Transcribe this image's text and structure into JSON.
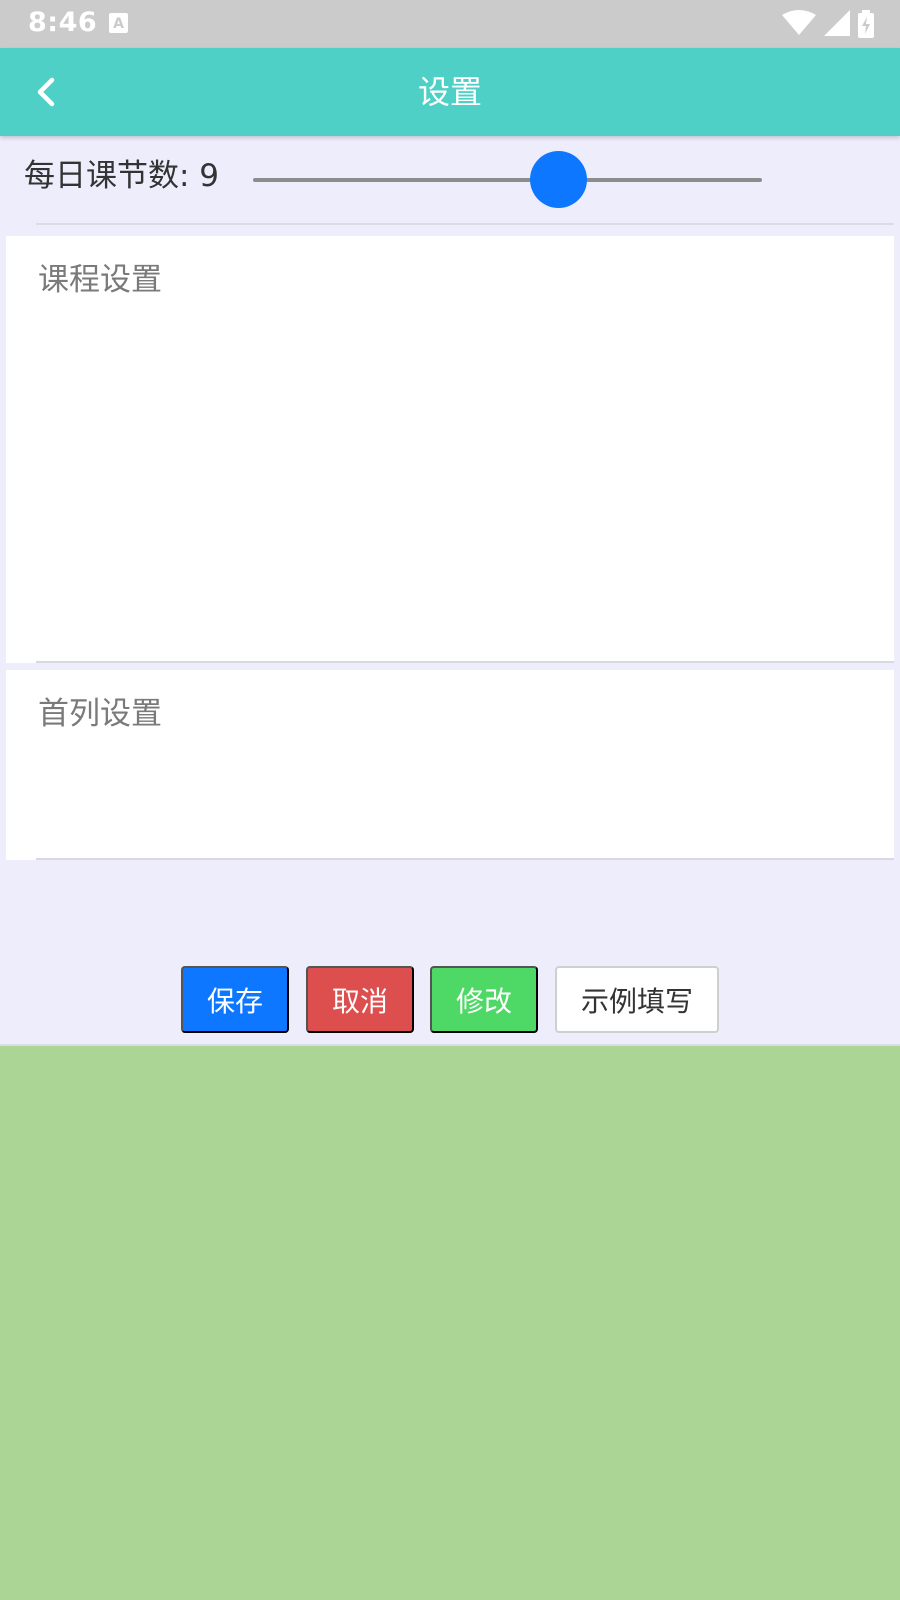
{
  "status_bar": {
    "time": "8:46",
    "icons": [
      "a-notification-icon",
      "wifi-icon",
      "signal-icon",
      "battery-charging-icon"
    ]
  },
  "app_bar": {
    "title": "设置",
    "back_icon": "chevron-left-icon"
  },
  "slider": {
    "label": "每日课节数: 9",
    "fill_fraction": 0.6,
    "color": "#0d78ff"
  },
  "panels": {
    "course": {
      "label": "课程设置",
      "value": ""
    },
    "first_column": {
      "label": "首列设置",
      "value": ""
    }
  },
  "buttons": {
    "save": "保存",
    "cancel": "取消",
    "edit": "修改",
    "example": "示例填写"
  },
  "colors": {
    "status_bar": "#cbcbcb",
    "app_bar": "#4fd0c7",
    "content_bg": "#eeedfc",
    "footer_bg": "#aad595",
    "save": "#0d78ff",
    "cancel": "#dd4f4f",
    "edit": "#4ed865"
  }
}
